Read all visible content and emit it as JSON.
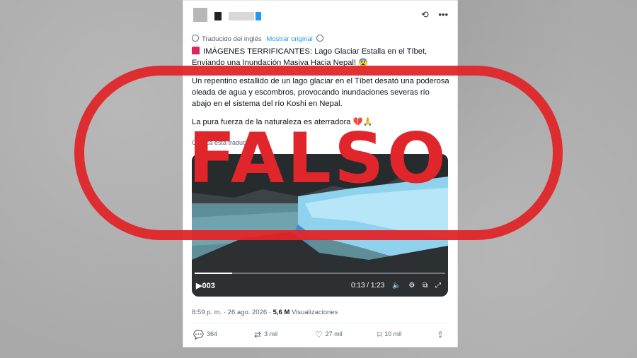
{
  "post": {
    "translation_note": "Traducido del inglés",
    "show_original": "Mostrar original",
    "headline": "IMÁGENES TERRIFICANTES: Lago Glaciar Estalla en el Tíbet, Enviando una Inundación Masiva Hacia Nepal! 😨",
    "paragraph": "Un repentino estallido de un lago glaciar en el Tíbet desató una poderosa oleada de agua y escombros, provocando inundaciones severas río abajo en el sistema del río Koshi en Nepal.",
    "closing": "La pura fuerza de la naturaleza es aterradora 💔🙏",
    "feedback": "Califica esta traducción",
    "video": {
      "counter": "003",
      "time": "0:13 / 1:23",
      "progress": 0.15
    },
    "timestamp": "8:59 p. m. · 26 ago. 2026 ·",
    "views": "5,6 M",
    "views_label": "Visualizaciones",
    "actions": {
      "replies": "364",
      "reposts": "3 mil",
      "likes": "27 mil",
      "bookmarks": "10 mil"
    }
  },
  "stamp": {
    "text": "FALSO",
    "color": "#e0262a"
  },
  "icons": [
    "grok-icon",
    "more-icon",
    "globe-icon",
    "play-icon",
    "volume-icon",
    "settings-icon",
    "pip-icon",
    "fullscreen-icon",
    "reply-icon",
    "repost-icon",
    "like-icon",
    "bookmark-icon",
    "share-icon"
  ]
}
